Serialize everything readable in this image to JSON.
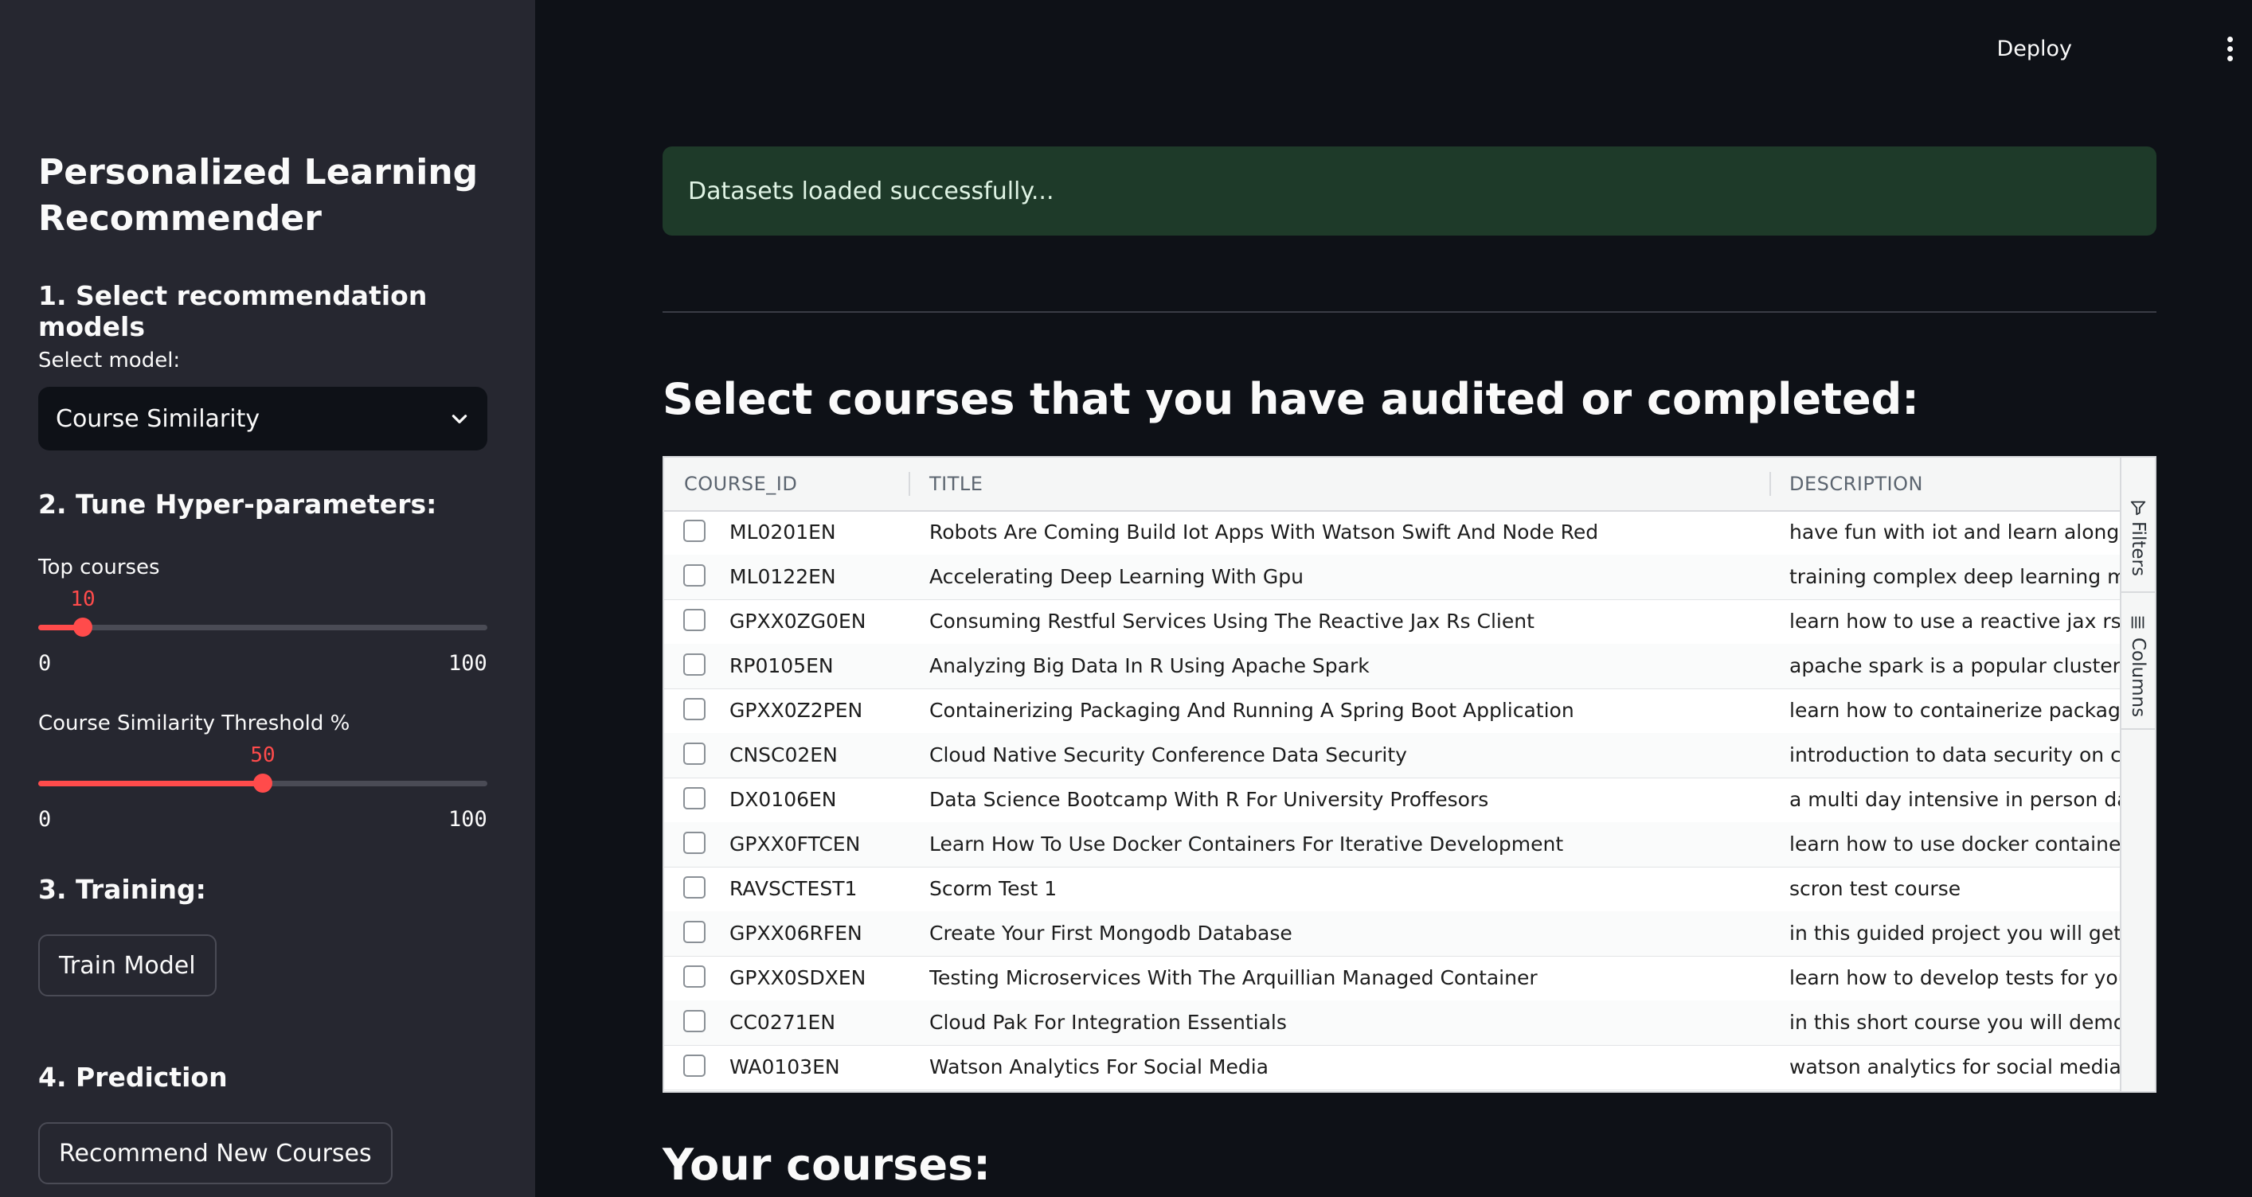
{
  "sidebar": {
    "title": "Personalized Learning Recommender",
    "section1": "1. Select recommendation models",
    "select_label": "Select model:",
    "select_value": "Course Similarity",
    "section2": "2. Tune Hyper-parameters:",
    "top_courses": {
      "label": "Top courses",
      "value": "10",
      "min": "0",
      "max": "100",
      "fraction": 0.1
    },
    "threshold": {
      "label": "Course Similarity Threshold %",
      "value": "50",
      "min": "0",
      "max": "100",
      "fraction": 0.5
    },
    "section3": "3. Training:",
    "train_button": "Train Model",
    "section4": "4. Prediction",
    "recommend_button": "Recommend New Courses"
  },
  "topbar": {
    "deploy": "Deploy"
  },
  "main": {
    "alert": "Datasets loaded successfully...",
    "heading": "Select courses that you have audited or completed:",
    "heading2": "Your courses:"
  },
  "grid": {
    "columns": [
      "COURSE_ID",
      "TITLE",
      "DESCRIPTION"
    ],
    "side_tabs": [
      "Filters",
      "Columns"
    ],
    "rows": [
      {
        "id": "ML0201EN",
        "title": "Robots Are Coming Build Iot Apps With Watson Swift And Node Red",
        "desc": "have fun with iot and learn along the"
      },
      {
        "id": "ML0122EN",
        "title": "Accelerating Deep Learning With Gpu",
        "desc": "training complex deep learning mode"
      },
      {
        "id": "GPXX0ZG0EN",
        "title": "Consuming Restful Services Using The Reactive Jax Rs Client",
        "desc": "learn how to use a reactive jax rs clie"
      },
      {
        "id": "RP0105EN",
        "title": "Analyzing Big Data In R Using Apache Spark",
        "desc": "apache spark is a popular cluster con"
      },
      {
        "id": "GPXX0Z2PEN",
        "title": "Containerizing Packaging And Running A Spring Boot Application",
        "desc": "learn how to containerize package an"
      },
      {
        "id": "CNSC02EN",
        "title": "Cloud Native Security Conference Data Security",
        "desc": "introduction to data security on cloud"
      },
      {
        "id": "DX0106EN",
        "title": "Data Science Bootcamp With R For University Proffesors",
        "desc": "a multi day intensive in person data s"
      },
      {
        "id": "GPXX0FTCEN",
        "title": "Learn How To Use Docker Containers For Iterative Development",
        "desc": "learn how to use docker containers fo"
      },
      {
        "id": "RAVSCTEST1",
        "title": "Scorm Test 1",
        "desc": "scron test course"
      },
      {
        "id": "GPXX06RFEN",
        "title": "Create Your First Mongodb Database",
        "desc": "in this guided project you will get star"
      },
      {
        "id": "GPXX0SDXEN",
        "title": "Testing Microservices With The Arquillian Managed Container",
        "desc": "learn how to develop tests for your m"
      },
      {
        "id": "CC0271EN",
        "title": "Cloud Pak For Integration Essentials",
        "desc": "in this short course you will demonstr"
      },
      {
        "id": "WA0103EN",
        "title": "Watson Analytics For Social Media",
        "desc": "watson analytics for social media fun"
      }
    ]
  }
}
